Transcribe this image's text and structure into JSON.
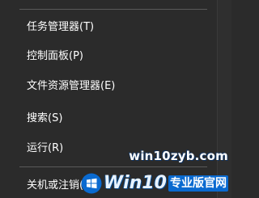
{
  "menu": {
    "items": [
      {
        "label": "任务管理器(T)"
      },
      {
        "label": "控制面板(P)"
      },
      {
        "label": "文件资源管理器(E)"
      },
      {
        "label": "搜索(S)"
      },
      {
        "label": "运行(R)"
      },
      {
        "label": "关机或注销(U)"
      }
    ]
  },
  "watermark": {
    "url": "win10zyb.com",
    "brand": "Win10",
    "tagline": "专业版官网",
    "icon": "windows-flag-icon"
  },
  "colors": {
    "menu_background": "#2b2b2b",
    "text": "#ffffff",
    "separator": "#5a5a5a",
    "watermark_blue": "#0a6ad0"
  }
}
